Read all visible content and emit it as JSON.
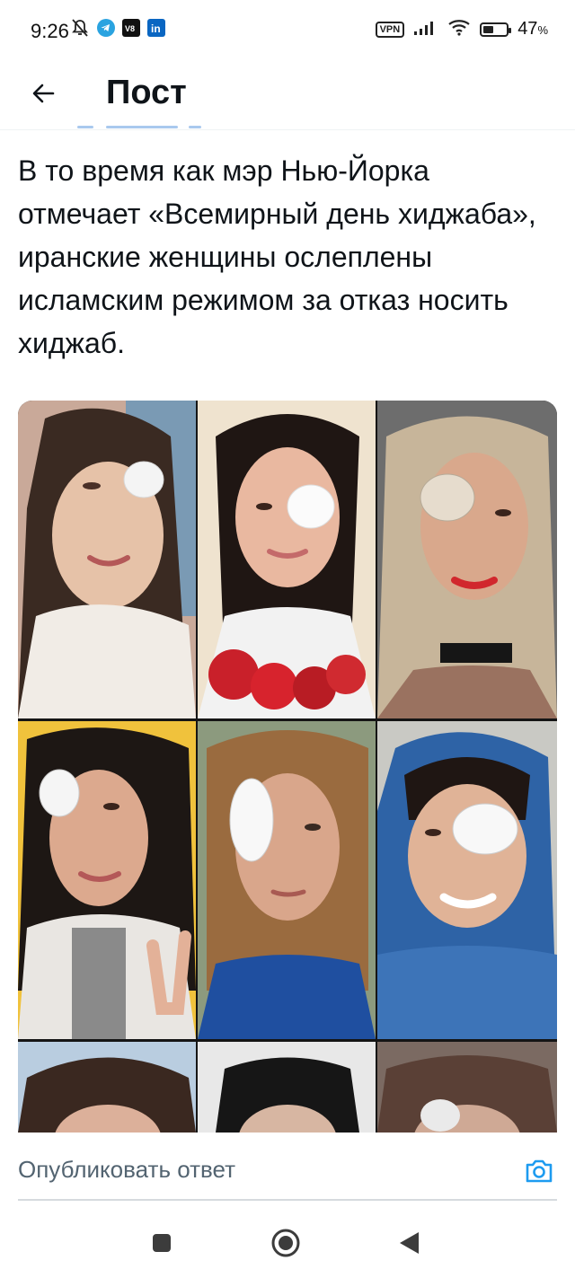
{
  "status_bar": {
    "time": "9:26",
    "battery_pct": "47",
    "battery_unit": "%",
    "battery_level": 0.47,
    "icons": [
      "mute-icon",
      "telegram-icon",
      "app-icon",
      "linkedin-icon",
      "vpn-icon",
      "signal-icon",
      "wifi-icon",
      "battery-icon"
    ],
    "vpn_label": "VPN"
  },
  "header": {
    "title": "Пост",
    "back_icon": "arrow-left-icon"
  },
  "post": {
    "text": "В то время как мэр Нью-Йорка отмечает «Всемирный день хиджаба», иранские женщины ослеплены исламским режимом за отказ носить хиджаб."
  },
  "media": {
    "photo_count": 9
  },
  "reply": {
    "placeholder": "Опубликовать ответ",
    "camera_icon": "camera-icon"
  },
  "nav": {
    "icons": [
      "square-icon",
      "circle-icon",
      "triangle-back-icon"
    ]
  },
  "colors": {
    "accent": "#1d9bf0",
    "text": "#0f1419",
    "secondary_text": "#536471"
  }
}
